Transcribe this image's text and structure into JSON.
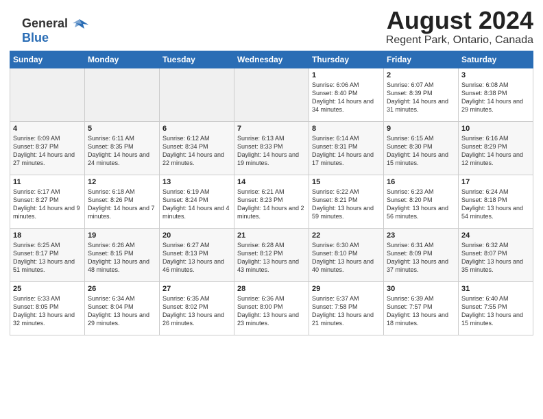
{
  "header": {
    "month_year": "August 2024",
    "location": "Regent Park, Ontario, Canada",
    "logo_general": "General",
    "logo_blue": "Blue"
  },
  "weekdays": [
    "Sunday",
    "Monday",
    "Tuesday",
    "Wednesday",
    "Thursday",
    "Friday",
    "Saturday"
  ],
  "weeks": [
    [
      {
        "day": "",
        "empty": true
      },
      {
        "day": "",
        "empty": true
      },
      {
        "day": "",
        "empty": true
      },
      {
        "day": "",
        "empty": true
      },
      {
        "day": "1",
        "sunrise": "6:06 AM",
        "sunset": "8:40 PM",
        "daylight": "14 hours and 34 minutes."
      },
      {
        "day": "2",
        "sunrise": "6:07 AM",
        "sunset": "8:39 PM",
        "daylight": "14 hours and 31 minutes."
      },
      {
        "day": "3",
        "sunrise": "6:08 AM",
        "sunset": "8:38 PM",
        "daylight": "14 hours and 29 minutes."
      }
    ],
    [
      {
        "day": "4",
        "sunrise": "6:09 AM",
        "sunset": "8:37 PM",
        "daylight": "14 hours and 27 minutes."
      },
      {
        "day": "5",
        "sunrise": "6:11 AM",
        "sunset": "8:35 PM",
        "daylight": "14 hours and 24 minutes."
      },
      {
        "day": "6",
        "sunrise": "6:12 AM",
        "sunset": "8:34 PM",
        "daylight": "14 hours and 22 minutes."
      },
      {
        "day": "7",
        "sunrise": "6:13 AM",
        "sunset": "8:33 PM",
        "daylight": "14 hours and 19 minutes."
      },
      {
        "day": "8",
        "sunrise": "6:14 AM",
        "sunset": "8:31 PM",
        "daylight": "14 hours and 17 minutes."
      },
      {
        "day": "9",
        "sunrise": "6:15 AM",
        "sunset": "8:30 PM",
        "daylight": "14 hours and 15 minutes."
      },
      {
        "day": "10",
        "sunrise": "6:16 AM",
        "sunset": "8:29 PM",
        "daylight": "14 hours and 12 minutes."
      }
    ],
    [
      {
        "day": "11",
        "sunrise": "6:17 AM",
        "sunset": "8:27 PM",
        "daylight": "14 hours and 9 minutes."
      },
      {
        "day": "12",
        "sunrise": "6:18 AM",
        "sunset": "8:26 PM",
        "daylight": "14 hours and 7 minutes."
      },
      {
        "day": "13",
        "sunrise": "6:19 AM",
        "sunset": "8:24 PM",
        "daylight": "14 hours and 4 minutes."
      },
      {
        "day": "14",
        "sunrise": "6:21 AM",
        "sunset": "8:23 PM",
        "daylight": "14 hours and 2 minutes."
      },
      {
        "day": "15",
        "sunrise": "6:22 AM",
        "sunset": "8:21 PM",
        "daylight": "13 hours and 59 minutes."
      },
      {
        "day": "16",
        "sunrise": "6:23 AM",
        "sunset": "8:20 PM",
        "daylight": "13 hours and 56 minutes."
      },
      {
        "day": "17",
        "sunrise": "6:24 AM",
        "sunset": "8:18 PM",
        "daylight": "13 hours and 54 minutes."
      }
    ],
    [
      {
        "day": "18",
        "sunrise": "6:25 AM",
        "sunset": "8:17 PM",
        "daylight": "13 hours and 51 minutes."
      },
      {
        "day": "19",
        "sunrise": "6:26 AM",
        "sunset": "8:15 PM",
        "daylight": "13 hours and 48 minutes."
      },
      {
        "day": "20",
        "sunrise": "6:27 AM",
        "sunset": "8:13 PM",
        "daylight": "13 hours and 46 minutes."
      },
      {
        "day": "21",
        "sunrise": "6:28 AM",
        "sunset": "8:12 PM",
        "daylight": "13 hours and 43 minutes."
      },
      {
        "day": "22",
        "sunrise": "6:30 AM",
        "sunset": "8:10 PM",
        "daylight": "13 hours and 40 minutes."
      },
      {
        "day": "23",
        "sunrise": "6:31 AM",
        "sunset": "8:09 PM",
        "daylight": "13 hours and 37 minutes."
      },
      {
        "day": "24",
        "sunrise": "6:32 AM",
        "sunset": "8:07 PM",
        "daylight": "13 hours and 35 minutes."
      }
    ],
    [
      {
        "day": "25",
        "sunrise": "6:33 AM",
        "sunset": "8:05 PM",
        "daylight": "13 hours and 32 minutes."
      },
      {
        "day": "26",
        "sunrise": "6:34 AM",
        "sunset": "8:04 PM",
        "daylight": "13 hours and 29 minutes."
      },
      {
        "day": "27",
        "sunrise": "6:35 AM",
        "sunset": "8:02 PM",
        "daylight": "13 hours and 26 minutes."
      },
      {
        "day": "28",
        "sunrise": "6:36 AM",
        "sunset": "8:00 PM",
        "daylight": "13 hours and 23 minutes."
      },
      {
        "day": "29",
        "sunrise": "6:37 AM",
        "sunset": "7:58 PM",
        "daylight": "13 hours and 21 minutes."
      },
      {
        "day": "30",
        "sunrise": "6:39 AM",
        "sunset": "7:57 PM",
        "daylight": "13 hours and 18 minutes."
      },
      {
        "day": "31",
        "sunrise": "6:40 AM",
        "sunset": "7:55 PM",
        "daylight": "13 hours and 15 minutes."
      }
    ]
  ]
}
